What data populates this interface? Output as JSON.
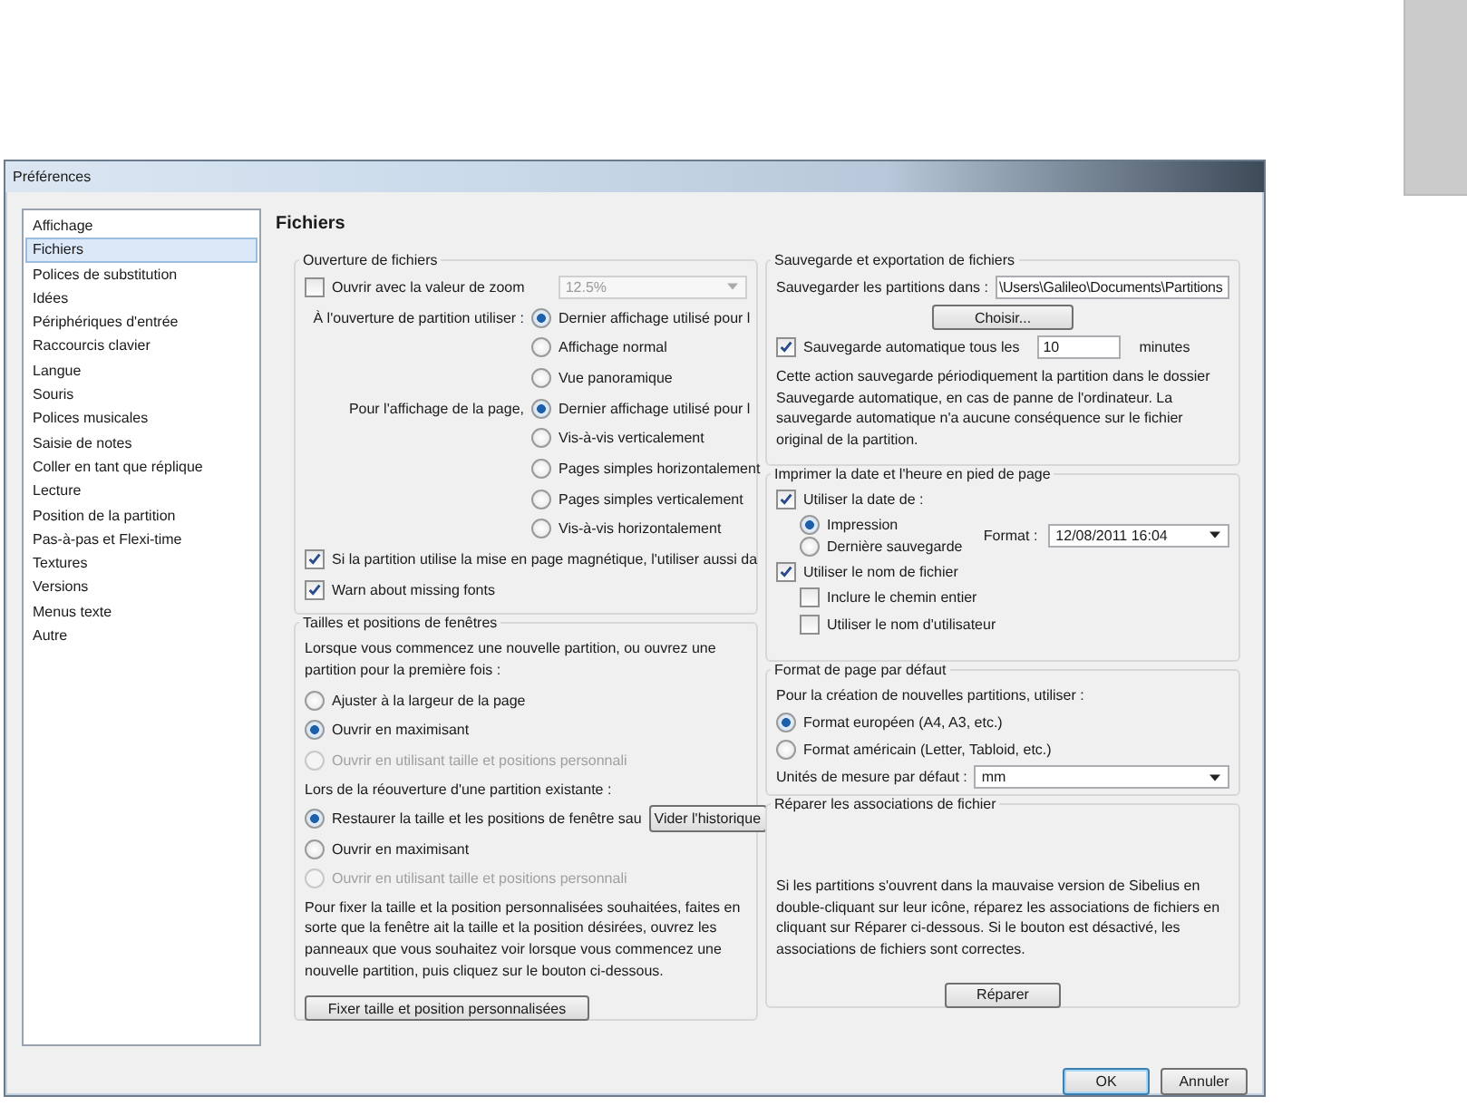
{
  "window": {
    "title": "Préférences"
  },
  "sidebar": {
    "items": [
      {
        "label": "Affichage",
        "selected": false
      },
      {
        "label": "Fichiers",
        "selected": true
      },
      {
        "label": "Polices de substitution",
        "selected": false
      },
      {
        "label": "Idées",
        "selected": false
      },
      {
        "label": "Périphériques d'entrée",
        "selected": false
      },
      {
        "label": "Raccourcis clavier",
        "selected": false
      },
      {
        "label": "Langue",
        "selected": false
      },
      {
        "label": "Souris",
        "selected": false
      },
      {
        "label": "Polices musicales",
        "selected": false
      },
      {
        "label": "Saisie de notes",
        "selected": false
      },
      {
        "label": "Coller en tant que réplique",
        "selected": false
      },
      {
        "label": "Lecture",
        "selected": false
      },
      {
        "label": "Position de la partition",
        "selected": false
      },
      {
        "label": "Pas-à-pas et Flexi-time",
        "selected": false
      },
      {
        "label": "Textures",
        "selected": false
      },
      {
        "label": "Versions",
        "selected": false
      },
      {
        "label": "Menus texte",
        "selected": false
      },
      {
        "label": "Autre",
        "selected": false
      }
    ]
  },
  "page_title": "Fichiers",
  "file_opening": {
    "title": "Ouverture de fichiers",
    "zoom": {
      "label": "Ouvrir avec la valeur de zoom",
      "checked": false,
      "value": "12.5%",
      "disabled": true
    },
    "radio_groups": [
      {
        "label": "À l'ouverture de partition utiliser :",
        "options": [
          {
            "label": "Dernier affichage utilisé pour l",
            "selected": true
          },
          {
            "label": "Affichage normal",
            "selected": false
          },
          {
            "label": "Vue panoramique",
            "selected": false
          }
        ]
      },
      {
        "label": "Pour l'affichage de la page,",
        "options": [
          {
            "label": "Dernier affichage utilisé pour l",
            "selected": true
          },
          {
            "label": "Vis-à-vis verticalement",
            "selected": false
          },
          {
            "label": "Pages simples horizontalement",
            "selected": false
          },
          {
            "label": "Pages simples verticalement",
            "selected": false
          },
          {
            "label": "Vis-à-vis horizontalement",
            "selected": false
          }
        ]
      }
    ],
    "checkboxes": [
      {
        "label": "Si la partition utilise la mise en page magnétique, l'utiliser aussi da",
        "checked": true
      },
      {
        "label": "Warn about missing fonts",
        "checked": true
      }
    ]
  },
  "window_sizes": {
    "title": "Tailles et positions de fenêtres",
    "intro": "Lorsque vous commencez une nouvelle partition, ou ouvrez une partition pour la première fois :",
    "new_options": [
      {
        "label": "Ajuster à la largeur de la page",
        "selected": false,
        "disabled": false
      },
      {
        "label": "Ouvrir en maximisant",
        "selected": true,
        "disabled": false
      },
      {
        "label": "Ouvrir en utilisant taille et positions personnali",
        "selected": false,
        "disabled": true
      }
    ],
    "reopen_label": "Lors de la réouverture d'une partition existante :",
    "reopen_options": [
      {
        "label": "Restaurer la taille et les positions de fenêtre sau",
        "selected": true,
        "disabled": false
      },
      {
        "label": "Ouvrir en maximisant",
        "selected": false,
        "disabled": false
      },
      {
        "label": "Ouvrir en utilisant taille et positions personnali",
        "selected": false,
        "disabled": true
      }
    ],
    "clear_history_button": "Vider l'historique",
    "paragraph": "Pour fixer la taille et la position personnalisées souhaitées, faites en sorte que la fenêtre ait la taille et la position désirées, ouvrez les panneaux que vous souhaitez voir lorsque vous commencez une nouvelle partition, puis cliquez sur le bouton ci-dessous.",
    "set_button": "Fixer taille et position personnalisées"
  },
  "save": {
    "title": "Sauvegarde et exportation de fichiers",
    "path_label": "Sauvegarder les partitions dans :",
    "path_value": "\\Users\\Galileo\\Documents\\Partitions",
    "choose_button": "Choisir...",
    "autosave": {
      "label": "Sauvegarde automatique tous les",
      "checked": true,
      "value": "10",
      "unit": "minutes"
    },
    "paragraph": "Cette action sauvegarde périodiquement la partition dans le dossier Sauvegarde automatique, en cas de panne de l'ordinateur. La sauvegarde automatique n'a aucune conséquence sur le fichier original de la partition."
  },
  "footer_print": {
    "title": "Imprimer la date et l'heure en pied de page",
    "use_date": {
      "label": "Utiliser la date de :",
      "checked": true
    },
    "date_options": [
      {
        "label": "Impression",
        "selected": true
      },
      {
        "label": "Dernière sauvegarde",
        "selected": false
      }
    ],
    "format_label": "Format :",
    "format_value": "12/08/2011 16:04",
    "use_filename": {
      "label": "Utiliser le nom de fichier",
      "checked": true
    },
    "sub_options": [
      {
        "label": "Inclure le chemin entier",
        "checked": false
      },
      {
        "label": "Utiliser le nom d'utilisateur",
        "checked": false
      }
    ]
  },
  "page_format": {
    "title": "Format de page par défaut",
    "intro": "Pour la création de nouvelles partitions, utiliser :",
    "options": [
      {
        "label": "Format européen (A4, A3, etc.)",
        "selected": true
      },
      {
        "label": "Format américain (Letter, Tabloid, etc.)",
        "selected": false
      }
    ],
    "units_label": "Unités de mesure par défaut :",
    "units_value": "mm"
  },
  "repair": {
    "title": "Réparer les associations de fichier",
    "paragraph": "Si les partitions s'ouvrent dans la mauvaise version de Sibelius en double-cliquant sur leur icône, réparez les associations de fichiers en cliquant sur Réparer ci-dessous. Si le bouton est désactivé, les associations de fichiers sont correctes.",
    "button": "Réparer"
  },
  "buttons": [
    {
      "label": "OK",
      "default": true
    },
    {
      "label": "Annuler",
      "default": false
    }
  ]
}
